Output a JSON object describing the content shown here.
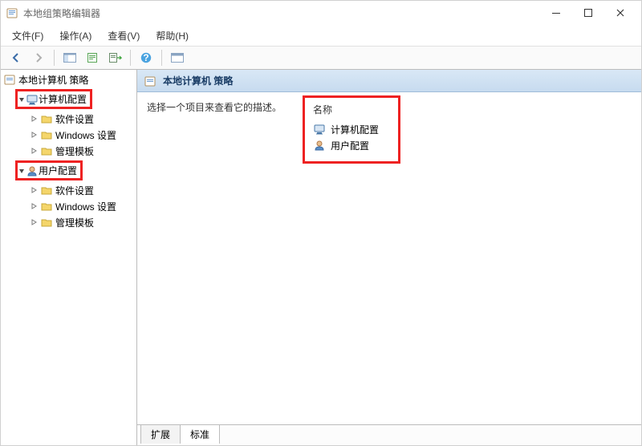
{
  "window": {
    "title": "本地组策略编辑器"
  },
  "menus": {
    "file": "文件(F)",
    "action": "操作(A)",
    "view": "查看(V)",
    "help": "帮助(H)"
  },
  "tree": {
    "root": "本地计算机 策略",
    "computer": "计算机配置",
    "user": "用户配置",
    "children": {
      "software": "软件设置",
      "windows": "Windows 设置",
      "admin": "管理模板"
    }
  },
  "detail": {
    "heading": "本地计算机 策略",
    "description": "选择一个项目来查看它的描述。",
    "column_name": "名称",
    "items": {
      "computer": "计算机配置",
      "user": "用户配置"
    }
  },
  "tabs": {
    "extended": "扩展",
    "standard": "标准"
  }
}
